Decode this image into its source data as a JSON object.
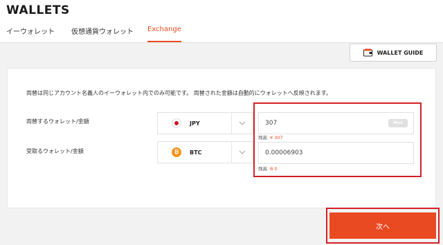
{
  "page": {
    "title": "WALLETS"
  },
  "tabs": [
    {
      "label": "イーウォレット"
    },
    {
      "label": "仮想通貨ウォレット"
    },
    {
      "label": "Exchange"
    }
  ],
  "wallet_guide": {
    "label": "WALLET GUIDE"
  },
  "notice": "両替は同じアカウント名義人のイーウォレット内でのみ可能です。 両替された金額は自動的にウォレットへ反映されます。",
  "from": {
    "label": "両替するウォレット/金額",
    "currency": "JPY",
    "amount": "307",
    "max_label": "Max",
    "balance_label": "残高",
    "balance_value": "¥ 307"
  },
  "to": {
    "label": "受取るウォレット/金額",
    "currency": "BTC",
    "currency_icon_glyph": "₿",
    "amount": "0.00006903",
    "balance_label": "残高",
    "balance_value": "B 0"
  },
  "next_button": {
    "label": "次へ"
  },
  "colors": {
    "accent": "#ea4a22",
    "highlight": "#d22027",
    "btc": "#f7931a",
    "jpy": "#d3132c"
  }
}
